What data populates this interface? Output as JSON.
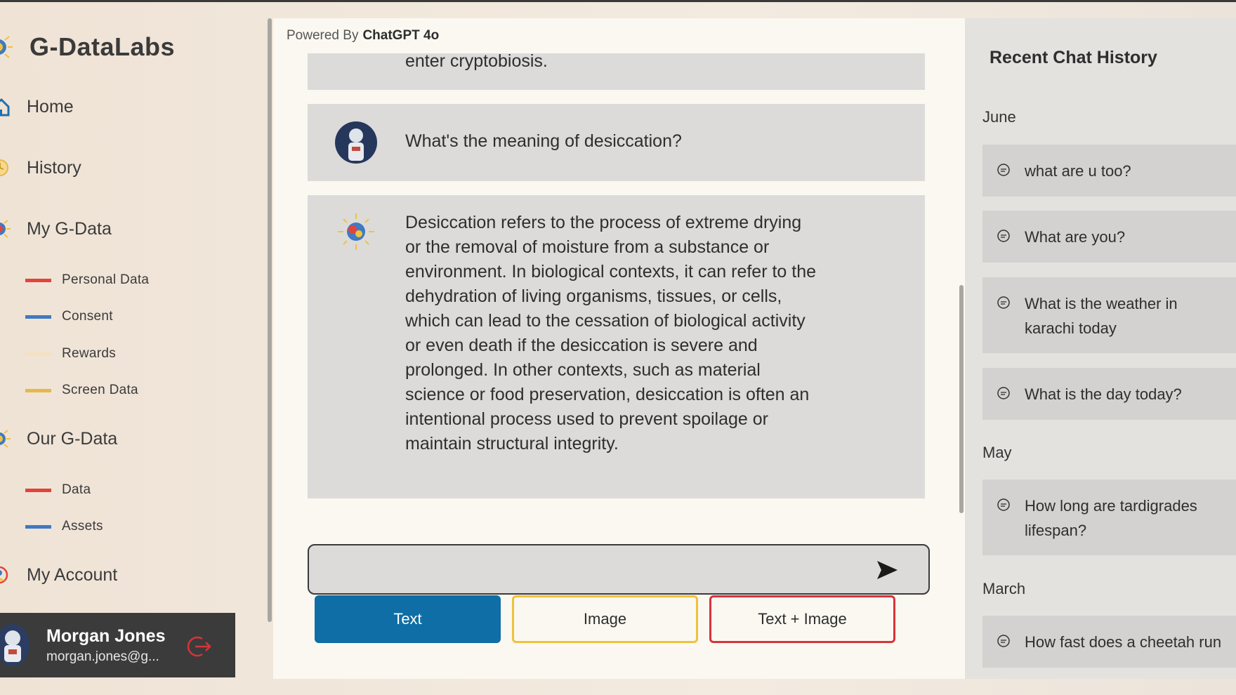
{
  "app": {
    "name": "G-DataLabs"
  },
  "sidebar": {
    "nav": [
      {
        "label": "Home"
      },
      {
        "label": "History"
      },
      {
        "label": "My G-Data"
      },
      {
        "label": "Our G-Data"
      },
      {
        "label": "My Account"
      }
    ],
    "my_gdata_items": [
      {
        "label": "Personal Data",
        "color": "#e2443b"
      },
      {
        "label": "Consent",
        "color": "#3f7ac2"
      },
      {
        "label": "Rewards",
        "color": "#f3e2bd"
      },
      {
        "label": "Screen Data",
        "color": "#e6b84a"
      }
    ],
    "our_gdata_items": [
      {
        "label": "Data",
        "color": "#e2443b"
      },
      {
        "label": "Assets",
        "color": "#3f7ac2"
      }
    ],
    "user": {
      "name": "Morgan Jones",
      "email": "morgan.jones@g..."
    }
  },
  "chat": {
    "powered_by_label": "Powered By",
    "powered_by_model": "ChatGPT 4o",
    "messages": [
      {
        "role": "assistant",
        "text": "enter cryptobiosis."
      },
      {
        "role": "user",
        "text": "What's the meaning of desiccation?"
      },
      {
        "role": "assistant",
        "text": "Desiccation refers to the process of extreme drying or the removal of moisture from a substance or environment. In biological contexts, it can refer to the dehydration of living organisms, tissues, or cells, which can lead to the cessation of biological activity or even death if the desiccation is severe and prolonged. In other contexts, such as material science or food preservation, desiccation is often an intentional process used to prevent spoilage or maintain structural integrity."
      }
    ],
    "input_value": "",
    "modes": [
      {
        "label": "Text",
        "active": true
      },
      {
        "label": "Image",
        "active": false
      },
      {
        "label": "Text + Image",
        "active": false
      }
    ]
  },
  "history": {
    "title": "Recent Chat History",
    "groups": [
      {
        "month": "June",
        "items": [
          "what are u too?",
          "What are you?",
          "What is the weather in karachi today",
          "What is the day today?"
        ]
      },
      {
        "month": "May",
        "items": [
          "How long are tardigrades lifespan?"
        ]
      },
      {
        "month": "March",
        "items": [
          "How fast does a cheetah run"
        ]
      }
    ]
  },
  "colors": {
    "accent_blue": "#0f6ea5",
    "accent_yellow": "#f0c23c",
    "accent_red": "#d8333a",
    "user_card_bg": "#3b3b3b"
  }
}
